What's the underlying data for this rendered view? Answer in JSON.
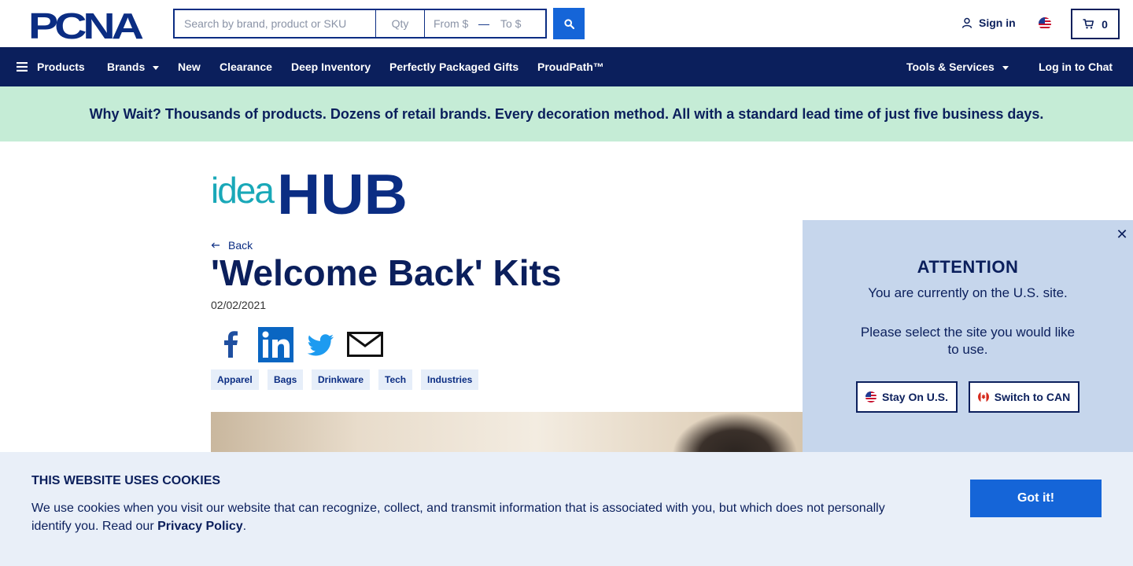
{
  "header": {
    "logo_text": "PCNA",
    "search": {
      "main_placeholder": "Search by brand, product or SKU",
      "qty_placeholder": "Qty",
      "from_placeholder": "From $",
      "dash": "—",
      "to_placeholder": "To $",
      "button_icon": "search-icon"
    },
    "signin_label": "Sign in",
    "region_flag": "us-flag-icon",
    "cart_count": "0"
  },
  "nav": {
    "items": [
      {
        "label": "Products",
        "icon": "menu-icon"
      },
      {
        "label": "Brands",
        "dropdown": true
      },
      {
        "label": "New"
      },
      {
        "label": "Clearance"
      },
      {
        "label": "Deep Inventory"
      },
      {
        "label": "Perfectly Packaged Gifts"
      },
      {
        "label": "ProudPath™"
      },
      {
        "label": "Tools & Services",
        "dropdown": true
      },
      {
        "label": "Log in to Chat"
      }
    ]
  },
  "promo": {
    "text": "Why Wait? Thousands of products. Dozens of retail brands. Every decoration method. All with a standard lead time of just five business days."
  },
  "article": {
    "brand_logo": {
      "light": "idea",
      "bold": "HUB"
    },
    "back_label": "Back",
    "title": "'Welcome Back' Kits",
    "date": "02/02/2021",
    "share_icons": [
      "facebook-icon",
      "linkedin-icon",
      "twitter-icon",
      "email-icon"
    ],
    "tags": [
      "Apparel",
      "Bags",
      "Drinkware",
      "Tech",
      "Industries"
    ]
  },
  "attention_modal": {
    "title": "ATTENTION",
    "message": "You are currently on the U.S. site.",
    "prompt": "Please select the site you would like to use.",
    "stay_label": "Stay On U.S.",
    "switch_label": "Switch to CAN",
    "close_icon": "close-icon"
  },
  "cookie_banner": {
    "title": "THIS WEBSITE USES COOKIES",
    "text": "We use cookies when you visit our website that can recognize, collect, and transmit information that is associated with you, but which does not personally identify you. Read our",
    "link_label": "Privacy Policy",
    "period": ".",
    "button_label": "Got it!"
  },
  "colors": {
    "navy": "#0b1f5c",
    "accent_blue": "#1565d8",
    "promo_bg": "#c5ecd6",
    "modal_bg": "#c6d6ec",
    "cookie_bg": "#e9eff8",
    "teal": "#19a8b8"
  }
}
